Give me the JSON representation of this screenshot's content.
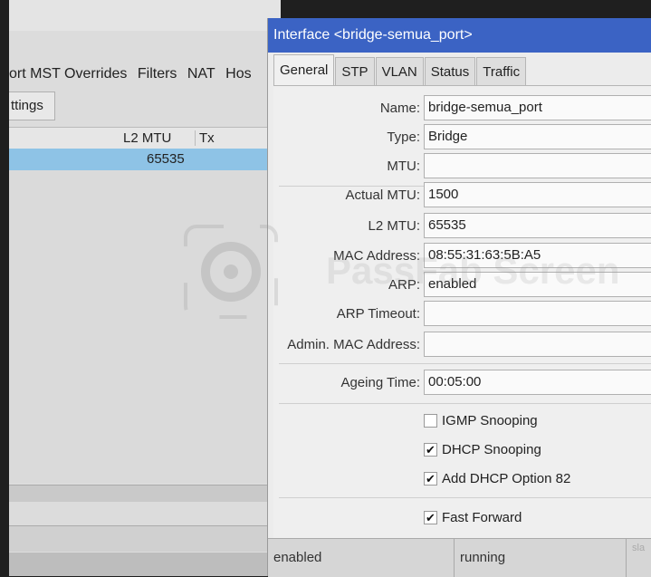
{
  "background_window": {
    "tabs": [
      "ort MST Overrides",
      "Filters",
      "NAT",
      "Hos"
    ],
    "settings_button": "ttings",
    "columns": [
      "L2 MTU",
      "Tx"
    ],
    "row": {
      "l2_mtu": "65535"
    }
  },
  "dialog": {
    "title": "Interface <bridge-semua_port>",
    "tabs": [
      "General",
      "STP",
      "VLAN",
      "Status",
      "Traffic"
    ],
    "fields": {
      "name": {
        "label": "Name:",
        "value": "bridge-semua_port"
      },
      "type": {
        "label": "Type:",
        "value": "Bridge"
      },
      "mtu": {
        "label": "MTU:",
        "value": ""
      },
      "actual_mtu": {
        "label": "Actual MTU:",
        "value": "1500"
      },
      "l2_mtu": {
        "label": "L2 MTU:",
        "value": "65535"
      },
      "mac_address": {
        "label": "MAC Address:",
        "value": "08:55:31:63:5B:A5"
      },
      "arp": {
        "label": "ARP:",
        "value": "enabled"
      },
      "arp_timeout": {
        "label": "ARP Timeout:",
        "value": ""
      },
      "admin_mac": {
        "label": "Admin. MAC Address:",
        "value": ""
      },
      "ageing_time": {
        "label": "Ageing Time:",
        "value": "00:05:00"
      }
    },
    "checkboxes": {
      "igmp_snooping": {
        "label": "IGMP Snooping",
        "checked": false
      },
      "dhcp_snooping": {
        "label": "DHCP Snooping",
        "checked": true
      },
      "add_dhcp_option_82": {
        "label": "Add DHCP Option 82",
        "checked": true
      },
      "fast_forward": {
        "label": "Fast Forward",
        "checked": true
      }
    },
    "status_bar": {
      "left": "enabled",
      "middle": "running",
      "right": "sla"
    }
  },
  "watermark": {
    "text": "PassFab Screen"
  }
}
